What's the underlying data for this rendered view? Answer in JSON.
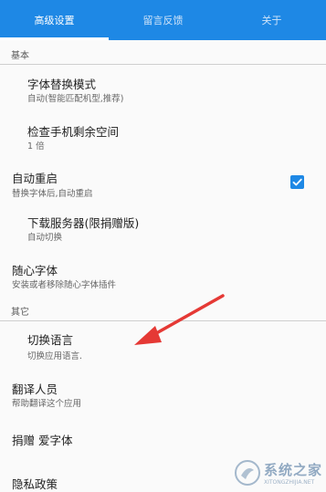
{
  "colors": {
    "accent": "#1e88e5",
    "arrow": "#e53935"
  },
  "tabs": [
    {
      "label": "高级设置",
      "active": true
    },
    {
      "label": "留言反馈",
      "active": false
    },
    {
      "label": "关于",
      "active": false
    }
  ],
  "sections": {
    "basic": "基本",
    "other": "其它"
  },
  "items": {
    "font_replace_mode": {
      "title": "字体替换模式",
      "subtitle": "自动(智能匹配机型,推荐)"
    },
    "check_storage": {
      "title": "检查手机剩余空间",
      "subtitle": "1 倍"
    },
    "auto_restart": {
      "title": "自动重启",
      "subtitle": "替换字体后,自动重启",
      "checked": true
    },
    "download_server": {
      "title": "下载服务器(限捐赠版)",
      "subtitle": "自动切换"
    },
    "free_font": {
      "title": "随心字体",
      "subtitle": "安装或者移除随心字体插件"
    },
    "switch_language": {
      "title": "切换语言",
      "subtitle": "切换应用语言."
    },
    "translators": {
      "title": "翻译人员",
      "subtitle": "帮助翻译这个应用"
    },
    "donate": {
      "title": "捐赠 爱字体"
    },
    "privacy": {
      "title": "隐私政策"
    }
  },
  "icons": {
    "checkbox": "check-icon",
    "annotation": "red-arrow"
  },
  "watermark": {
    "name": "系统之家",
    "url": "XITONGZHIJIA.NET"
  }
}
